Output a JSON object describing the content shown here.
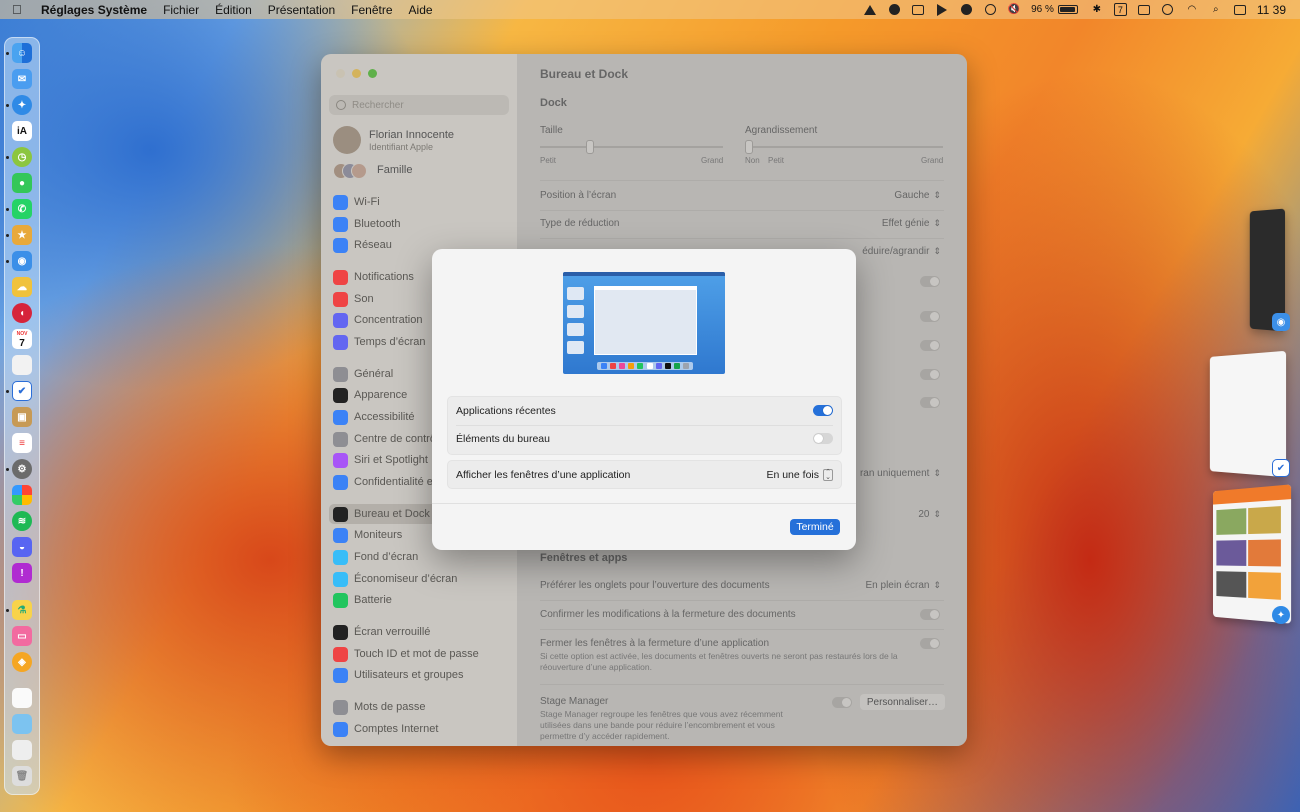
{
  "menubar": {
    "app_name": "Réglages Système",
    "menus": [
      "Fichier",
      "Édition",
      "Présentation",
      "Fenêtre",
      "Aide"
    ],
    "battery_percent": "96 %",
    "battery_level": 0.96,
    "calendar_day": "7",
    "clock": "11 39"
  },
  "dock": {
    "apps": [
      "finder",
      "mail",
      "safari",
      "ia-writer",
      "timing",
      "messages",
      "whatsapp",
      "reeder",
      "tweetbot",
      "icloud",
      "pocketcasts",
      "calendar",
      "notes-blank",
      "things",
      "archive",
      "reminders",
      "settings",
      "photos",
      "spotify",
      "discord",
      "speakline",
      "tower",
      "cleanmymac",
      "vectornator",
      "textedit",
      "preview",
      "files",
      "trash"
    ],
    "calendar_month": "NOV",
    "calendar_day": "7"
  },
  "window": {
    "title": "Bureau et Dock",
    "search_placeholder": "Rechercher",
    "profile": {
      "name": "Florian Innocente",
      "subtitle": "Identifiant Apple"
    },
    "family_label": "Famille",
    "sidebar": [
      {
        "label": "Wi-Fi",
        "icon": "wifi-icon",
        "color": "#3b82f6"
      },
      {
        "label": "Bluetooth",
        "icon": "bluetooth-icon",
        "color": "#3b82f6"
      },
      {
        "label": "Réseau",
        "icon": "globe-icon",
        "color": "#3b82f6"
      },
      {
        "label": "Notifications",
        "icon": "bell-icon",
        "color": "#ef4444"
      },
      {
        "label": "Son",
        "icon": "speaker-icon",
        "color": "#ef4444"
      },
      {
        "label": "Concentration",
        "icon": "moon-icon",
        "color": "#6366f1"
      },
      {
        "label": "Temps d’écran",
        "icon": "hourglass-icon",
        "color": "#6366f1"
      },
      {
        "label": "Général",
        "icon": "gear-icon",
        "color": "#8e8e93"
      },
      {
        "label": "Apparence",
        "icon": "appearance-icon",
        "color": "#222222"
      },
      {
        "label": "Accessibilité",
        "icon": "accessibility-icon",
        "color": "#3b82f6"
      },
      {
        "label": "Centre de contrô",
        "icon": "control-center-icon",
        "color": "#8e8e93"
      },
      {
        "label": "Siri et Spotlight",
        "icon": "siri-icon",
        "color": "#a855f7"
      },
      {
        "label": "Confidentialité et",
        "icon": "hand-icon",
        "color": "#3b82f6"
      },
      {
        "label": "Bureau et Dock",
        "icon": "dock-icon",
        "color": "#222222"
      },
      {
        "label": "Moniteurs",
        "icon": "display-icon",
        "color": "#3b82f6"
      },
      {
        "label": "Fond d’écran",
        "icon": "wallpaper-icon",
        "color": "#38bdf8"
      },
      {
        "label": "Économiseur d’écran",
        "icon": "screensaver-icon",
        "color": "#38bdf8"
      },
      {
        "label": "Batterie",
        "icon": "battery-icon",
        "color": "#22c55e"
      },
      {
        "label": "Écran verrouillé",
        "icon": "lock-icon",
        "color": "#222222"
      },
      {
        "label": "Touch ID et mot de passe",
        "icon": "fingerprint-icon",
        "color": "#ef4444"
      },
      {
        "label": "Utilisateurs et groupes",
        "icon": "users-icon",
        "color": "#3b82f6"
      },
      {
        "label": "Mots de passe",
        "icon": "key-icon",
        "color": "#8e8e93"
      },
      {
        "label": "Comptes Internet",
        "icon": "at-icon",
        "color": "#3b82f6"
      }
    ],
    "dock_section": "Dock",
    "size_label": "Taille",
    "size_min": "Petit",
    "size_max": "Grand",
    "size_value": 0.27,
    "magnification_label": "Agrandissement",
    "mag_off": "Non",
    "mag_min": "Petit",
    "mag_max": "Grand",
    "mag_value": 0.0,
    "position_label": "Position à l’écran",
    "position_value": "Gauche",
    "minimize_label": "Type de réduction",
    "minimize_value": "Effet génie",
    "dblclick_value": "éduire/agrandir",
    "stage_value_partial": "ran uniquement",
    "number_value": "20",
    "windows_section": "Fenêtres et apps",
    "tabs_label": "Préférer les onglets pour l’ouverture des documents",
    "tabs_value": "En plein écran",
    "confirm_label": "Confirmer les modifications à la fermeture des documents",
    "close_windows_label": "Fermer les fenêtres à la fermeture d’une application",
    "close_windows_note": "Si cette option est activée, les documents et fenêtres ouverts ne seront pas restaurés lors de la réouverture d’une application.",
    "stage_label": "Stage Manager",
    "stage_note": "Stage Manager regroupe les fenêtres que vous avez récemment utilisées dans une bande pour réduire l’encombrement et vous permettre d’y accéder rapidement.",
    "customize_button": "Personnaliser…"
  },
  "modal": {
    "recent_apps_label": "Applications récentes",
    "recent_apps_on": true,
    "desktop_items_label": "Éléments du bureau",
    "desktop_items_on": false,
    "show_windows_label": "Afficher les fenêtres d’une application",
    "show_windows_value": "En une fois",
    "done_button": "Terminé"
  }
}
